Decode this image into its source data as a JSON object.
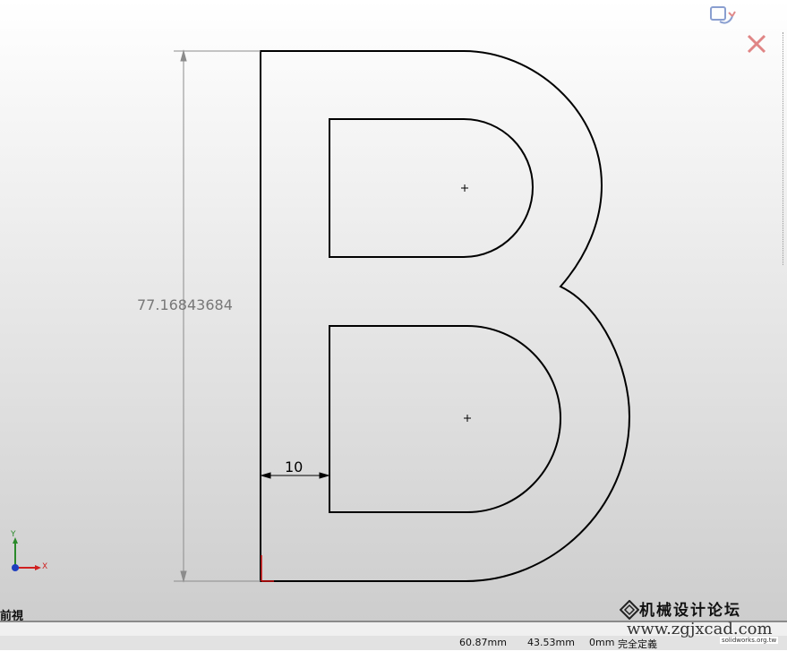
{
  "sketch": {
    "dimension_height": "77.16843684",
    "dimension_width": "10"
  },
  "triad": {
    "y_label": "Y",
    "x_label": "X"
  },
  "view": {
    "name": "前視"
  },
  "status_bar": {
    "x_coord": "60.87mm",
    "y_coord": "43.53mm",
    "z_coord": "0mm",
    "state": "完全定義"
  },
  "watermark": {
    "title": "机械设计论坛",
    "url": "www.zgjxcad.com",
    "sub": "solidworks.org.tw"
  },
  "icons": {
    "confirm": "confirm-rebuild-icon",
    "cancel": "close-icon",
    "triad": "coordinate-triad-icon"
  },
  "colors": {
    "outline": "#000000",
    "dimension": "#8c8c8c",
    "origin": "#d01010",
    "cancel": "#e07070"
  }
}
